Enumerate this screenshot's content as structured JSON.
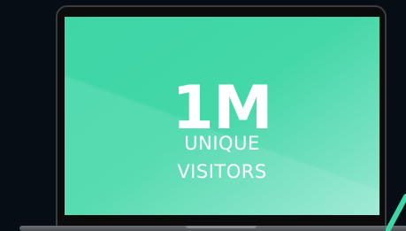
{
  "stat": {
    "value": "1M",
    "label_line1": "UNIQUE",
    "label_line2": "VISITORS"
  },
  "colors": {
    "background": "#060d14",
    "screen_accent": "#44d7a8",
    "text": "#ffffff"
  },
  "icons": {
    "device": "laptop-icon",
    "accent": "accent-stroke-icon"
  }
}
